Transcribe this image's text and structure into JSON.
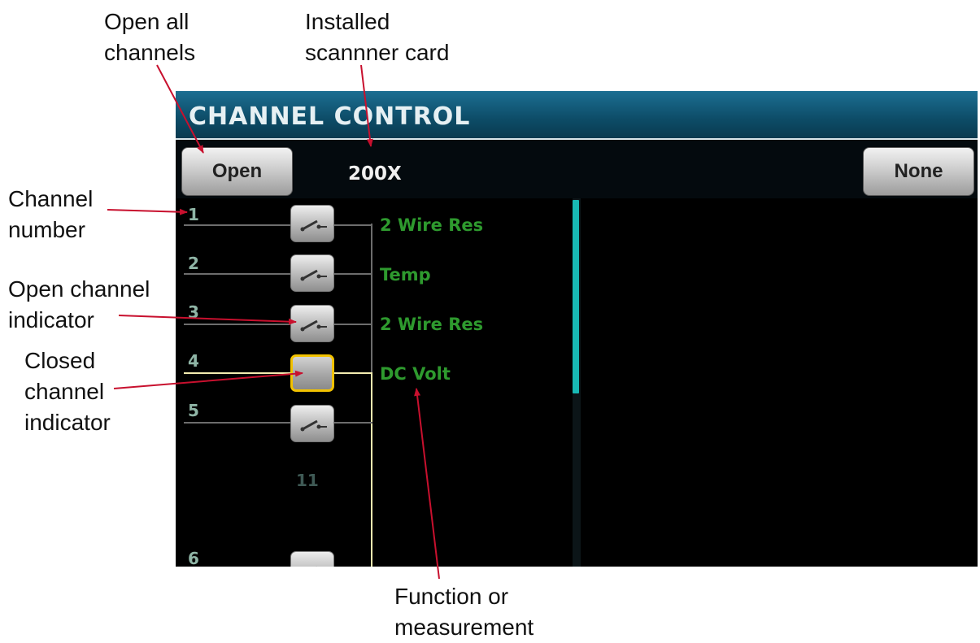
{
  "callouts": {
    "open_all": [
      "Open all",
      "channels"
    ],
    "installed_card": [
      "Installed",
      "scannner card"
    ],
    "channel_number": [
      "Channel",
      "number"
    ],
    "open_indicator": [
      "Open channel",
      "indicator"
    ],
    "closed_indicator": [
      "Closed",
      "channel",
      "indicator"
    ],
    "function": [
      "Function or",
      "measurement"
    ]
  },
  "screen": {
    "title": "CHANNEL CONTROL",
    "open_button": "Open",
    "card_label": "200X",
    "none_button": "None",
    "slot_label": "11",
    "scroll_position": 0.0,
    "channels": [
      {
        "number": "1",
        "function": "2 Wire Res",
        "state": "open"
      },
      {
        "number": "2",
        "function": "Temp",
        "state": "open"
      },
      {
        "number": "3",
        "function": "2 Wire Res",
        "state": "open"
      },
      {
        "number": "4",
        "function": "DC Volt",
        "state": "closed"
      },
      {
        "number": "5",
        "function": "",
        "state": "open"
      },
      {
        "number": "6",
        "function": "",
        "state": "open"
      }
    ]
  },
  "colors": {
    "titlebar": "#0d4c67",
    "function_text": "#2e9a2e",
    "closed_highlight": "#f2c200",
    "closed_wire": "#f3ecb0",
    "scroll_thumb": "#18b9b4",
    "annotation_arrow": "#c8102e"
  }
}
